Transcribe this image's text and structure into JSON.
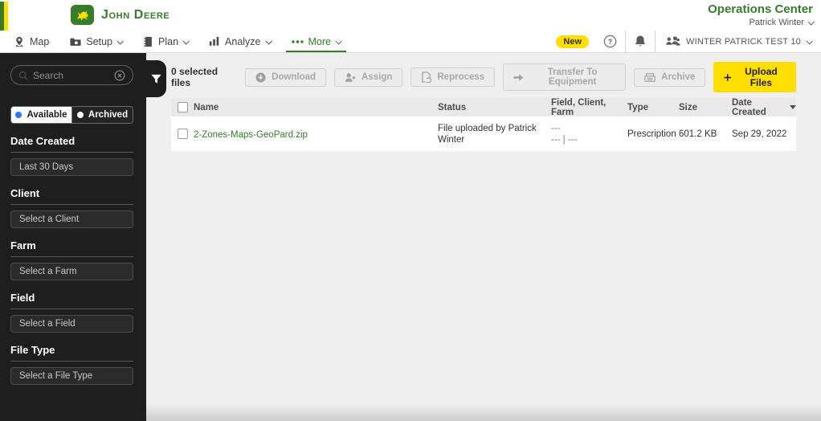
{
  "header": {
    "brand": "John Deere",
    "app_title": "Operations Center",
    "user_menu": "Patrick Winter"
  },
  "nav": {
    "items": [
      {
        "label": "Map"
      },
      {
        "label": "Setup"
      },
      {
        "label": "Plan"
      },
      {
        "label": "Analyze"
      },
      {
        "label": "More"
      }
    ],
    "new_badge": "New",
    "org_menu": "WINTER PATRICK TEST 10"
  },
  "sidebar": {
    "search_placeholder": "Search",
    "toggle": {
      "available": "Available",
      "archived": "Archived",
      "selected": "Available"
    },
    "filters": [
      {
        "label": "Date Created",
        "value": "Last 30 Days"
      },
      {
        "label": "Client",
        "value": "Select a Client"
      },
      {
        "label": "Farm",
        "value": "Select a Farm"
      },
      {
        "label": "Field",
        "value": "Select a Field"
      },
      {
        "label": "File Type",
        "value": "Select a File Type"
      }
    ]
  },
  "toolbar": {
    "selected_count": "0 selected files",
    "buttons": [
      "Download",
      "Assign",
      "Reprocess",
      "Transfer To Equipment",
      "Archive"
    ],
    "upload_label": "Upload Files"
  },
  "table": {
    "columns": [
      "Name",
      "Status",
      "Field, Client, Farm",
      "Type",
      "Size",
      "Date Created"
    ],
    "sort_column": "Date Created",
    "sort_direction": "desc",
    "rows": [
      {
        "name": "2-Zones-Maps-GeoPard.zip",
        "status": "File uploaded by Patrick Winter",
        "field_client_farm_line1": "---",
        "field_client_farm_line2": "--- | ---",
        "type": "Prescription",
        "size": "601.2 KB",
        "date_created": "Sep 29, 2022"
      }
    ]
  },
  "colors": {
    "brand_green": "#367C2B",
    "brand_yellow": "#FFDE00",
    "sidebar_bg": "#1e1e1e",
    "link_green": "#367C2B"
  }
}
